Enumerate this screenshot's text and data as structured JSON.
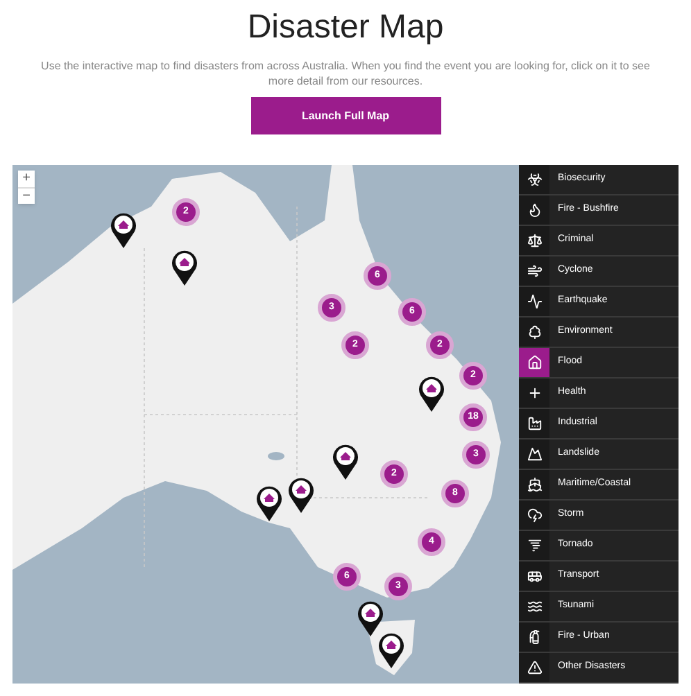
{
  "title": "Disaster Map",
  "description": "Use the interactive map to find disasters from across Australia.  When you find the event you are looking for, click on it to see more detail from our resources.",
  "launch_button": "Launch Full Map",
  "map": {
    "zoom_in": "+",
    "zoom_out": "−",
    "clusters": [
      {
        "count": "2"
      },
      {
        "count": "6"
      },
      {
        "count": "3"
      },
      {
        "count": "6"
      },
      {
        "count": "2"
      },
      {
        "count": "2"
      },
      {
        "count": "2"
      },
      {
        "count": "18"
      },
      {
        "count": "3"
      },
      {
        "count": "2"
      },
      {
        "count": "8"
      },
      {
        "count": "4"
      },
      {
        "count": "6"
      },
      {
        "count": "3"
      }
    ],
    "pins": [
      {
        "kind": "flood"
      },
      {
        "kind": "flood"
      },
      {
        "kind": "flood"
      },
      {
        "kind": "flood"
      },
      {
        "kind": "flood"
      },
      {
        "kind": "flood"
      },
      {
        "kind": "flood"
      },
      {
        "kind": "flood"
      }
    ]
  },
  "categories": [
    {
      "label": "Biosecurity",
      "selected": false
    },
    {
      "label": "Fire - Bushfire",
      "selected": false
    },
    {
      "label": "Criminal",
      "selected": false
    },
    {
      "label": "Cyclone",
      "selected": false
    },
    {
      "label": "Earthquake",
      "selected": false
    },
    {
      "label": "Environment",
      "selected": false
    },
    {
      "label": "Flood",
      "selected": true
    },
    {
      "label": "Health",
      "selected": false
    },
    {
      "label": "Industrial",
      "selected": false
    },
    {
      "label": "Landslide",
      "selected": false
    },
    {
      "label": "Maritime/Coastal",
      "selected": false
    },
    {
      "label": "Storm",
      "selected": false
    },
    {
      "label": "Tornado",
      "selected": false
    },
    {
      "label": "Transport",
      "selected": false
    },
    {
      "label": "Tsunami",
      "selected": false
    },
    {
      "label": "Fire - Urban",
      "selected": false
    },
    {
      "label": "Other Disasters",
      "selected": false
    }
  ]
}
